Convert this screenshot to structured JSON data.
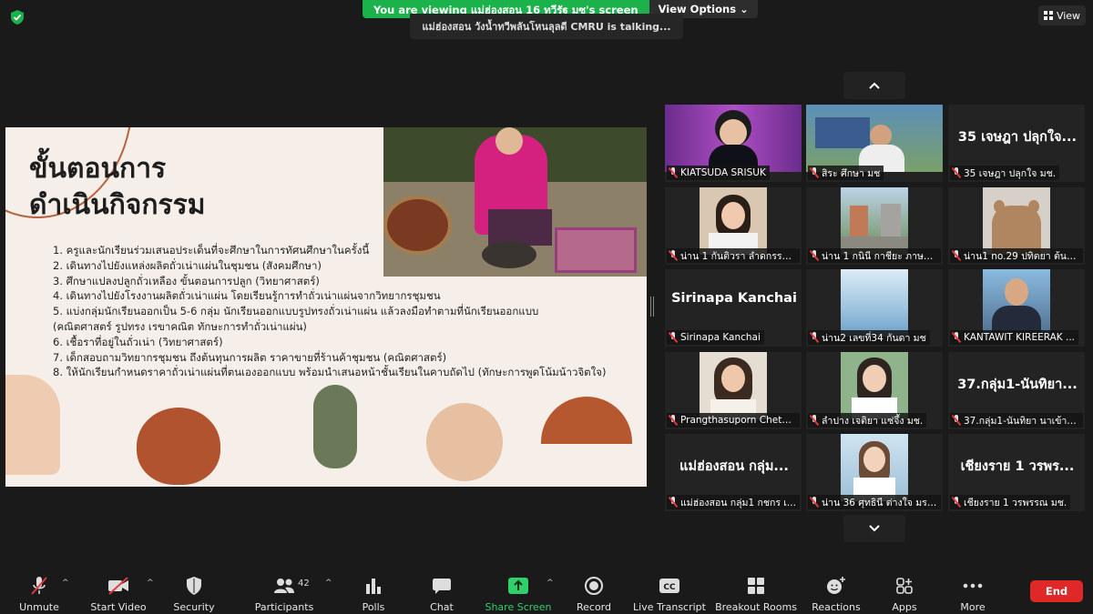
{
  "top": {
    "share_message": "You are viewing แม่ฮ่องสอน 16 ทวีรัฐ มซ's screen",
    "view_options": "View Options",
    "talking": "แม่ฮ่องสอน วังน้ำทวีพลันโหนลุลดี CMRU is talking...",
    "view_label": "View"
  },
  "slide": {
    "title_line1": "ขั้นตอนการ",
    "title_line2": "ดำเนินกิจกรรม",
    "items": [
      "1. ครูและนักเรียนร่วมเสนอประเด็นที่จะศึกษาในการทัศนศึกษาในครั้งนี้",
      "2. เดินทางไปยังแหล่งผลิตถั่วเน่าแผ่นในชุมชน (สังคมศึกษา)",
      "3. ศึกษาแปลงปลูกถั่วเหลือง ขั้นตอนการปลูก  (วิทยาศาสตร์)",
      "4. เดินทางไปยังโรงงานผลิตถั่วเน่าแผ่น โดยเรียนรู้การทำถั่วเน่าแผ่นจากวิทยากรชุมชน",
      "5. แบ่งกลุ่มนักเรียนออกเป็น 5-6 กลุ่ม นักเรียนออกแบบรูปทรงถั่วเน่าแผ่น แล้วลงมือทำตามที่นักเรียนออกแบบ",
      "    (คณิตศาสตร์ รูปทรง      เรขาคณิต       ทักษะการทำถั่วเน่าแผ่น)",
      "6. เชื้อราที่อยู่ในถั่วเน่า (วิทยาศาสตร์)",
      "7. เด็กสอบถามวิทยากรชุมชน ถึงต้นทุนการผลิต ราคาขายที่ร้านค้าชุมชน (คณิตศาสตร์)",
      "8. ให้นักเรียนกำหนดราคาถั่วเน่าแผ่นที่ตนเองออกแบบ พร้อมนำเสนอหน้าชั้นเรียนในคาบถัดไป (ทักษะการพูดโน้มน้าวจิตใจ)"
    ]
  },
  "gallery": {
    "up_icon": "chevron-up-icon",
    "down_icon": "chevron-down-icon",
    "tiles": [
      {
        "name": "KIATSUDA SRISUK",
        "big": ""
      },
      {
        "name": "สิระ ศึกษา มช",
        "big": ""
      },
      {
        "name": "35 เจษฎา ปลุกใจ มช.",
        "big": "35 เจษฎา ปลุกใจ..."
      },
      {
        "name": "น่าน 1 กันติวรา ลำดกรรจ์ ...",
        "big": ""
      },
      {
        "name": "น่าน 1 กนินี กาชียะ ภาษาไ...",
        "big": ""
      },
      {
        "name": "น่าน1 no.29 ปทิตยา ต้นผ...",
        "big": ""
      },
      {
        "name": "Sirinapa Kanchai",
        "big": "Sirinapa Kanchai"
      },
      {
        "name": "น่าน2 เลขที่34 กันดา มช",
        "big": ""
      },
      {
        "name": "KANTAWIT KIREERAK ...",
        "big": ""
      },
      {
        "name": "Prangthasuporn Chetu...",
        "big": ""
      },
      {
        "name": "ลำปาง เจติยา แซ่จึ้ง มช.",
        "big": ""
      },
      {
        "name": "37.กลุ่ม1-นันทิยา นาเข้าตั...",
        "big": "37.กลุ่ม1-นันทิยา..."
      },
      {
        "name": "แม่ฮ่องสอน กลุ่ม1 กชกร เ...",
        "big": "แม่ฮ่องสอน กลุ่ม..."
      },
      {
        "name": "น่าน 36 ศุทธินี ต่างใจ มรภ...",
        "big": ""
      },
      {
        "name": "เชียงราย 1 วรพรรณ มช.",
        "big": "เชียงราย 1 วรพร..."
      }
    ]
  },
  "toolbar": {
    "unmute": "Unmute",
    "start_video": "Start Video",
    "security": "Security",
    "participants": "Participants",
    "participants_count": "42",
    "polls": "Polls",
    "chat": "Chat",
    "share_screen": "Share Screen",
    "record": "Record",
    "live_transcript": "Live Transcript",
    "breakout_rooms": "Breakout Rooms",
    "reactions": "Reactions",
    "apps": "Apps",
    "more": "More",
    "end": "End"
  },
  "colors": {
    "share_banner": "#1bb24b",
    "end_button": "#e02828",
    "share_icon": "#2fcf6a",
    "muted_icon": "#e0393e"
  }
}
